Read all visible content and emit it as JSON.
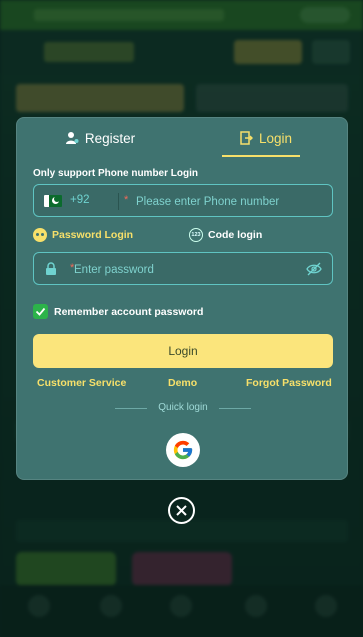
{
  "tabs": [
    {
      "label": "Register",
      "icon": "user-icon",
      "active": false
    },
    {
      "label": "Login",
      "icon": "login-door-icon",
      "active": true
    }
  ],
  "form": {
    "subtitle": "Only support Phone number Login",
    "country_code": "+92",
    "country_flag": "pakistan-flag-icon",
    "phone_placeholder": "Please enter Phone number",
    "required_mark": "*",
    "modes": {
      "password": "Password Login",
      "code": "Code login"
    },
    "code_icon_text": "123",
    "password_placeholder": "Enter password",
    "remember_label": "Remember account password",
    "remember_checked": true,
    "login_label": "Login"
  },
  "links": {
    "customer_service": "Customer Service",
    "demo": "Demo",
    "forgot": "Forgot Password"
  },
  "quick_login": {
    "label": "Quick login",
    "providers": [
      "google-icon"
    ]
  },
  "colors": {
    "accent": "#f7e06a",
    "modal": "#3f7370",
    "field_border": "#5fc4c2",
    "button": "#fbe57c",
    "check": "#2cb34a"
  }
}
